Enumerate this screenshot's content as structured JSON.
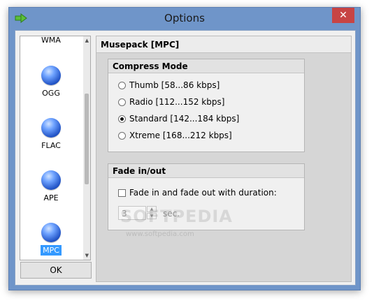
{
  "window": {
    "title": "Options",
    "close_glyph": "✕"
  },
  "formats": [
    {
      "label": "WMA",
      "icon": "format-ball-icon"
    },
    {
      "label": "OGG",
      "icon": "format-ball-icon"
    },
    {
      "label": "FLAC",
      "icon": "format-ball-icon"
    },
    {
      "label": "APE",
      "icon": "format-ball-icon"
    },
    {
      "label": "MPC",
      "icon": "format-ball-icon",
      "selected": true
    }
  ],
  "ok_label": "OK",
  "panel": {
    "title": "Musepack [MPC]",
    "compress_mode": {
      "title": "Compress Mode",
      "options": [
        {
          "label": "Thumb [58...86 kbps]",
          "checked": false
        },
        {
          "label": "Radio [112...152 kbps]",
          "checked": false
        },
        {
          "label": "Standard [142...184 kbps]",
          "checked": true
        },
        {
          "label": "Xtreme [168...212 kbps]",
          "checked": false
        }
      ]
    },
    "fade": {
      "title": "Fade in/out",
      "checkbox_label": "Fade in and fade out with duration:",
      "checked": false,
      "duration_value": "3",
      "unit": "sec."
    }
  },
  "watermark": {
    "text": "SOFTPEDIA",
    "url": "www.softpedia.com"
  },
  "colors": {
    "selection": "#3399ff",
    "close_button": "#c74444",
    "frame": "#6f95c9"
  }
}
